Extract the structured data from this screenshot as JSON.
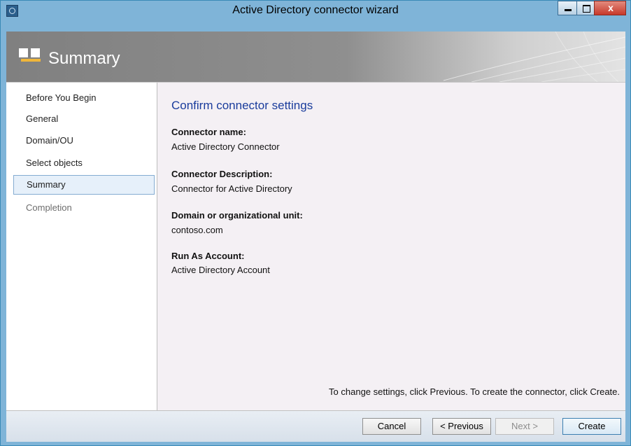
{
  "window": {
    "title": "Active Directory connector wizard",
    "close_glyph": "x"
  },
  "header": {
    "title": "Summary"
  },
  "nav": {
    "items": [
      {
        "label": "Before You Begin"
      },
      {
        "label": "General"
      },
      {
        "label": "Domain/OU"
      },
      {
        "label": "Select objects"
      },
      {
        "label": "Summary",
        "selected": true
      },
      {
        "label": "Completion",
        "disabled": true
      }
    ]
  },
  "content": {
    "heading": "Confirm connector settings",
    "fields": [
      {
        "label": "Connector name:",
        "value": "Active Directory Connector"
      },
      {
        "label": "Connector Description:",
        "value": "Connector for Active Directory"
      },
      {
        "label": "Domain or organizational unit:",
        "value": "contoso.com"
      },
      {
        "label": "Run As Account:",
        "value": "Active Directory Account"
      }
    ],
    "hint": "To change settings, click Previous. To create the connector, click Create."
  },
  "footer": {
    "cancel": "Cancel",
    "previous": "< Previous",
    "next": "Next >",
    "create": "Create"
  },
  "colors": {
    "titlebar": "#7fb4d8",
    "heading": "#1a3c9c",
    "selected_bg": "#e6f0fa",
    "header_icon_bar": "#f0b63a"
  }
}
